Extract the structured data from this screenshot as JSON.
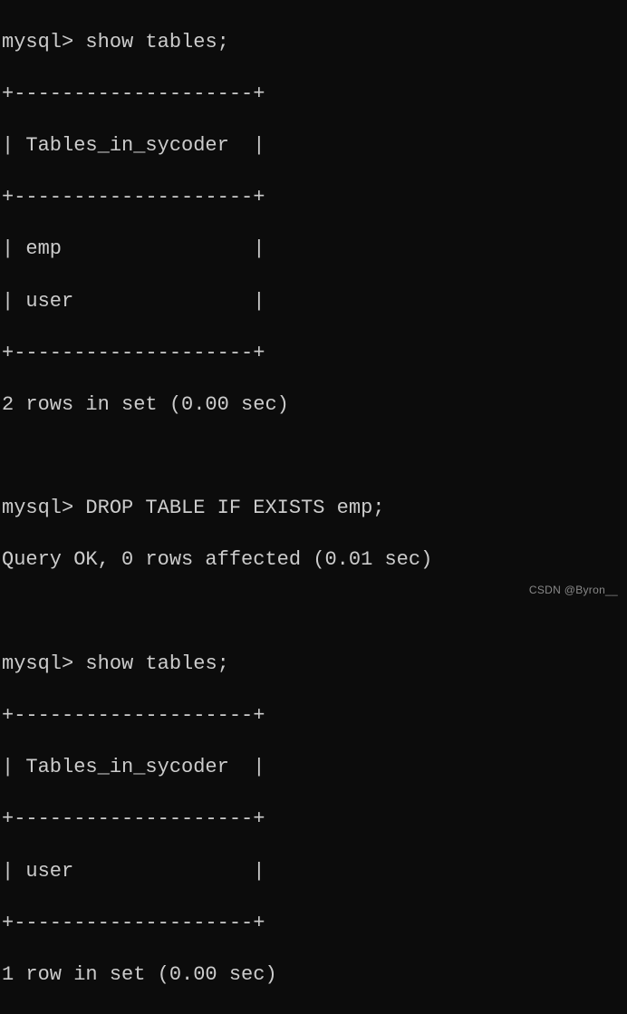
{
  "prompt": "mysql>",
  "commands": {
    "show_tables_1": "show tables;",
    "drop_table": "DROP TABLE IF EXISTS emp;",
    "show_tables_2": "show tables;"
  },
  "table_output_1": {
    "border_top": "+--------------------+",
    "header": "| Tables_in_sycoder  |",
    "border_mid": "+--------------------+",
    "rows": [
      "| emp                |",
      "| user               |"
    ],
    "border_bottom": "+--------------------+",
    "summary": "2 rows in set (0.00 sec)"
  },
  "drop_result": "Query OK, 0 rows affected (0.01 sec)",
  "table_output_2": {
    "border_top": "+--------------------+",
    "header": "| Tables_in_sycoder  |",
    "border_mid": "+--------------------+",
    "rows": [
      "| user               |"
    ],
    "border_bottom": "+--------------------+",
    "summary": "1 row in set (0.00 sec)"
  },
  "watermark": "CSDN @Byron__"
}
